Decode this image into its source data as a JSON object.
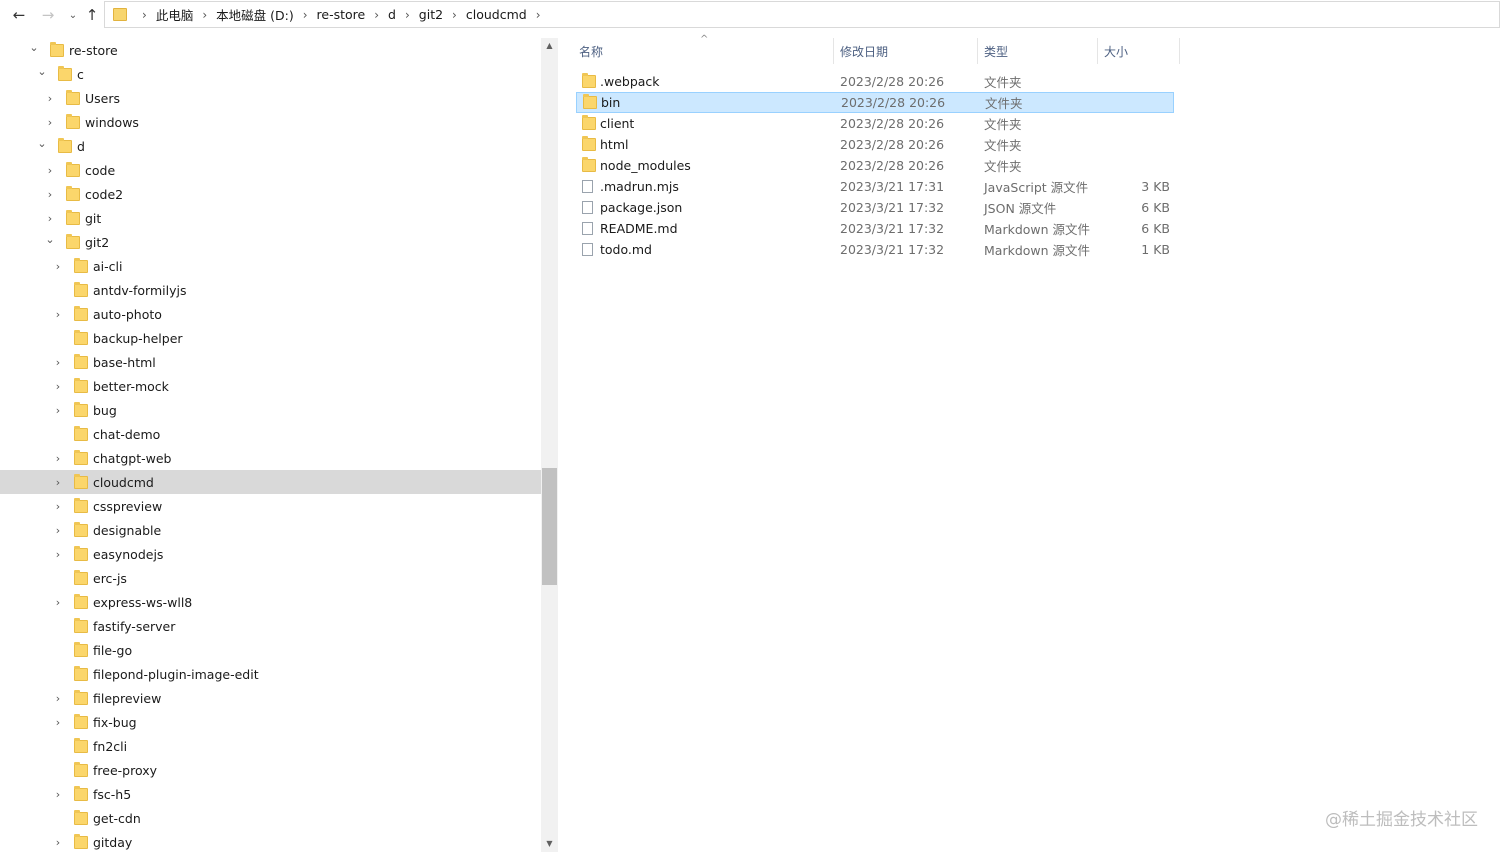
{
  "breadcrumb": [
    "此电脑",
    "本地磁盘 (D:)",
    "re-store",
    "d",
    "git2",
    "cloudcmd"
  ],
  "nav": {
    "back_icon": "←",
    "forward_icon": "→",
    "recent_icon": "⌄",
    "up_icon": "↑",
    "crumb_sep": "›"
  },
  "tree": [
    {
      "label": "re-store",
      "depth": 0,
      "state": "expanded"
    },
    {
      "label": "c",
      "depth": 1,
      "state": "expanded"
    },
    {
      "label": "Users",
      "depth": 2,
      "state": "collapsed"
    },
    {
      "label": "windows",
      "depth": 2,
      "state": "collapsed"
    },
    {
      "label": "d",
      "depth": 1,
      "state": "expanded"
    },
    {
      "label": "code",
      "depth": 2,
      "state": "collapsed"
    },
    {
      "label": "code2",
      "depth": 2,
      "state": "collapsed"
    },
    {
      "label": "git",
      "depth": 2,
      "state": "collapsed"
    },
    {
      "label": "git2",
      "depth": 2,
      "state": "expanded"
    },
    {
      "label": "ai-cli",
      "depth": 3,
      "state": "collapsed"
    },
    {
      "label": "antdv-formilyjs",
      "depth": 3,
      "state": "none"
    },
    {
      "label": "auto-photo",
      "depth": 3,
      "state": "collapsed"
    },
    {
      "label": "backup-helper",
      "depth": 3,
      "state": "none"
    },
    {
      "label": "base-html",
      "depth": 3,
      "state": "collapsed"
    },
    {
      "label": "better-mock",
      "depth": 3,
      "state": "collapsed"
    },
    {
      "label": "bug",
      "depth": 3,
      "state": "collapsed"
    },
    {
      "label": "chat-demo",
      "depth": 3,
      "state": "none"
    },
    {
      "label": "chatgpt-web",
      "depth": 3,
      "state": "collapsed"
    },
    {
      "label": "cloudcmd",
      "depth": 3,
      "state": "collapsed",
      "selected": true
    },
    {
      "label": "csspreview",
      "depth": 3,
      "state": "collapsed"
    },
    {
      "label": "designable",
      "depth": 3,
      "state": "collapsed"
    },
    {
      "label": "easynodejs",
      "depth": 3,
      "state": "collapsed"
    },
    {
      "label": "erc-js",
      "depth": 3,
      "state": "none"
    },
    {
      "label": "express-ws-wll8",
      "depth": 3,
      "state": "collapsed"
    },
    {
      "label": "fastify-server",
      "depth": 3,
      "state": "none"
    },
    {
      "label": "file-go",
      "depth": 3,
      "state": "none"
    },
    {
      "label": "filepond-plugin-image-edit",
      "depth": 3,
      "state": "none"
    },
    {
      "label": "filepreview",
      "depth": 3,
      "state": "collapsed"
    },
    {
      "label": "fix-bug",
      "depth": 3,
      "state": "collapsed"
    },
    {
      "label": "fn2cli",
      "depth": 3,
      "state": "none"
    },
    {
      "label": "free-proxy",
      "depth": 3,
      "state": "none"
    },
    {
      "label": "fsc-h5",
      "depth": 3,
      "state": "collapsed"
    },
    {
      "label": "get-cdn",
      "depth": 3,
      "state": "none"
    },
    {
      "label": "gitday",
      "depth": 3,
      "state": "collapsed"
    }
  ],
  "columns": {
    "name": "名称",
    "date": "修改日期",
    "type": "类型",
    "size": "大小",
    "sort_icon": "^"
  },
  "files": [
    {
      "name": ".webpack",
      "date": "2023/2/28 20:26",
      "type": "文件夹",
      "size": "",
      "kind": "folder"
    },
    {
      "name": "bin",
      "date": "2023/2/28 20:26",
      "type": "文件夹",
      "size": "",
      "kind": "folder",
      "selected": true
    },
    {
      "name": "client",
      "date": "2023/2/28 20:26",
      "type": "文件夹",
      "size": "",
      "kind": "folder"
    },
    {
      "name": "html",
      "date": "2023/2/28 20:26",
      "type": "文件夹",
      "size": "",
      "kind": "folder"
    },
    {
      "name": "node_modules",
      "date": "2023/2/28 20:26",
      "type": "文件夹",
      "size": "",
      "kind": "folder"
    },
    {
      "name": ".madrun.mjs",
      "date": "2023/3/21 17:31",
      "type": "JavaScript 源文件",
      "size": "3 KB",
      "kind": "js"
    },
    {
      "name": "package.json",
      "date": "2023/3/21 17:32",
      "type": "JSON 源文件",
      "size": "6 KB",
      "kind": "json"
    },
    {
      "name": "README.md",
      "date": "2023/3/21 17:32",
      "type": "Markdown 源文件",
      "size": "6 KB",
      "kind": "md"
    },
    {
      "name": "todo.md",
      "date": "2023/3/21 17:32",
      "type": "Markdown 源文件",
      "size": "1 KB",
      "kind": "md"
    }
  ],
  "watermark": "@稀土掘金技术社区",
  "scroll": {
    "up": "▲",
    "down": "▼"
  }
}
